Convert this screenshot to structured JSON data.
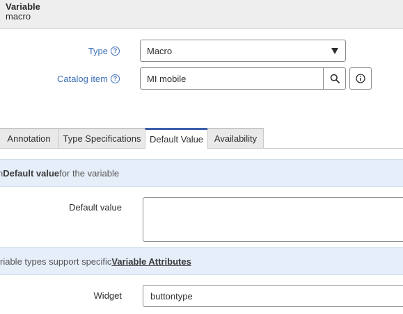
{
  "header": {
    "title": "Variable",
    "subtitle": "macro"
  },
  "form": {
    "type": {
      "label": "Type",
      "value": "Macro",
      "help_icon": "help-circle-icon"
    },
    "catalog_item": {
      "label": "Catalog item",
      "value": "MI mobile",
      "help_icon": "help-circle-icon",
      "lookup_icon": "search-icon",
      "info_icon": "info-icon"
    }
  },
  "tabs": [
    {
      "label": "Annotation",
      "active": false
    },
    {
      "label": "Type Specifications",
      "active": false
    },
    {
      "label": "Default Value",
      "active": true
    },
    {
      "label": "Availability",
      "active": false
    }
  ],
  "default_section": {
    "banner_lead": "n ",
    "banner_bold": "Default value",
    "banner_tail": " for the variable",
    "default_value_label": "Default value",
    "default_value": ""
  },
  "attributes_section": {
    "banner_lead": "riable types support specific ",
    "banner_link": "Variable Attributes",
    "widget_label": "Widget",
    "widget_value": "buttontype"
  },
  "colors": {
    "accent": "#3a5ea8",
    "label_link": "#3b6fb6",
    "banner_bg": "#e6eef9",
    "header_bg": "#eeeeee"
  }
}
